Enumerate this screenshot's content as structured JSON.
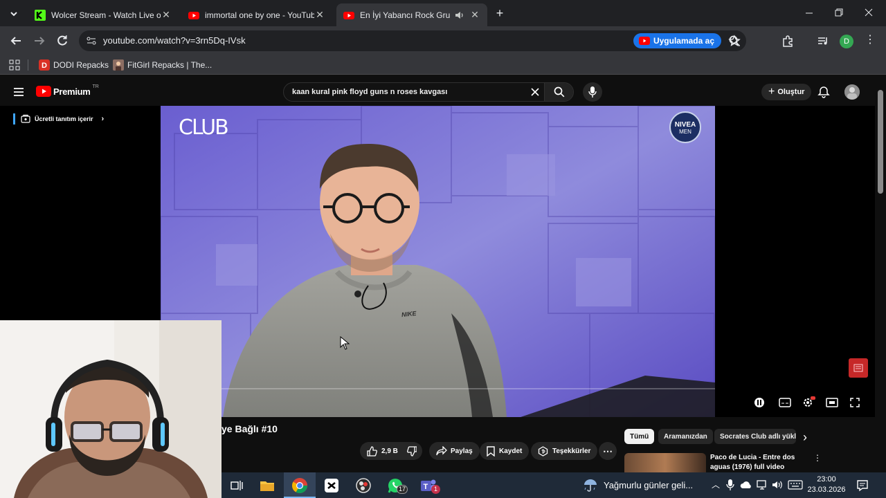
{
  "tabs": [
    {
      "title": "Wolcer Stream - Watch Live on",
      "active": false
    },
    {
      "title": "immortal one by one - YouTube",
      "active": false
    },
    {
      "title": "En İyi Yabancı Rock Grupları",
      "active": true
    }
  ],
  "address": {
    "url": "youtube.com/watch?v=3rn5Dq-IVsk",
    "open_in_app": "Uygulamada aç",
    "profile_letter": "D"
  },
  "bookmarks": [
    {
      "label": "DODI Repacks"
    },
    {
      "label": "FitGirl Repacks | The..."
    }
  ],
  "youtube": {
    "logo_text": "Premium",
    "region": "TR",
    "search_query": "kaan kural pink floyd guns n roses kavgası",
    "create_label": "Oluştur",
    "paid_promotion": "Ücretli tanıtım içerir",
    "video": {
      "channel_logo": "CLUB",
      "sponsor_top": "NIVEA",
      "sponsor_bottom": "MEN",
      "shirt_brand": "NIKE"
    },
    "title_fragment": "ye Bağlı #10",
    "likes": "2,9 B",
    "share": "Paylaş",
    "save": "Kaydet",
    "thanks": "Teşekkürler",
    "chips": [
      "Tümü",
      "Aramanızdan",
      "Socrates Club adlı yükle"
    ],
    "recommended": {
      "title": "Paco de Lucia - Entre dos aguas (1976) full video"
    }
  },
  "taskbar": {
    "weather": "Yağmurlu günler geli...",
    "time": "23:00",
    "date": "23.03.2026",
    "whatsapp_badge": "17",
    "teams_badge": "1"
  }
}
